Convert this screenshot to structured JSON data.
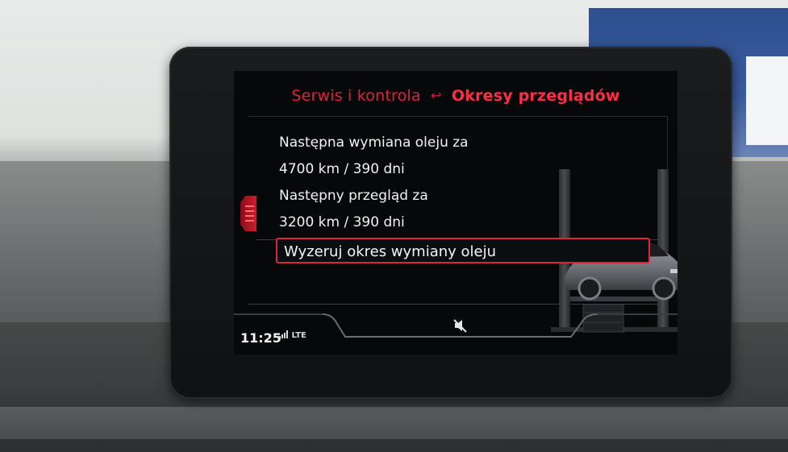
{
  "header": {
    "parent": "Serwis i kontrola",
    "back_icon": "back-arrow-icon",
    "current": "Okresy przeglądów"
  },
  "items": {
    "oil_label": "Następna wymiana oleju za",
    "oil_value": "4700 km / 390 dni",
    "service_label": "Następny przegląd za",
    "service_value": "3200 km / 390 dni",
    "reset_action": "Wyzeruj okres wymiany oleju"
  },
  "status": {
    "time": "11:25",
    "network": "LTE",
    "mute_icon": "speaker-mute-icon"
  },
  "colors": {
    "accent": "#e0223a",
    "text": "#f2f2f2",
    "screen_bg": "#07080a"
  }
}
